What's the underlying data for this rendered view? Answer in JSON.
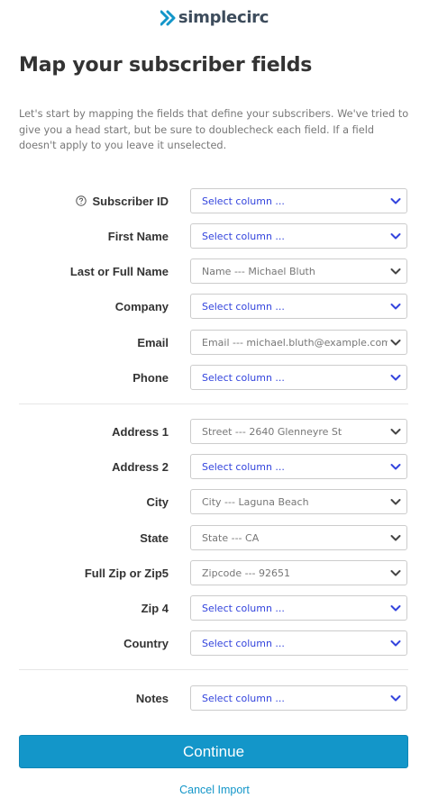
{
  "brand": {
    "name": "simplecirc",
    "accent": "#1396c9"
  },
  "page": {
    "title": "Map your subscriber fields",
    "intro": "Let's start by mapping the fields that define your subscribers. We've tried to give you a head start, but be sure to doublecheck each field. If a field doesn't apply to you leave it unselected."
  },
  "fields": [
    {
      "label": "Subscriber ID",
      "value": "Select column ...",
      "selected": false,
      "help_icon": "question-circle"
    },
    {
      "label": "First Name",
      "value": "Select column ...",
      "selected": false
    },
    {
      "label": "Last or Full Name",
      "value": "Name --- Michael Bluth",
      "selected": true
    },
    {
      "label": "Company",
      "value": "Select column ...",
      "selected": false
    },
    {
      "label": "Email",
      "value": "Email --- michael.bluth@example.com",
      "selected": true
    },
    {
      "label": "Phone",
      "value": "Select column ...",
      "selected": false
    },
    {
      "label": "Address 1",
      "value": "Street --- 2640 Glenneyre St",
      "selected": true
    },
    {
      "label": "Address 2",
      "value": "Select column ...",
      "selected": false
    },
    {
      "label": "City",
      "value": "City --- Laguna Beach",
      "selected": true
    },
    {
      "label": "State",
      "value": "State --- CA",
      "selected": true
    },
    {
      "label": "Full Zip or Zip5",
      "value": "Zipcode --- 92651",
      "selected": true
    },
    {
      "label": "Zip 4",
      "value": "Select column ...",
      "selected": false
    },
    {
      "label": "Country",
      "value": "Select column ...",
      "selected": false
    },
    {
      "label": "Notes",
      "value": "Select column ...",
      "selected": false
    }
  ],
  "actions": {
    "continue_label": "Continue",
    "cancel_label": "Cancel Import"
  }
}
